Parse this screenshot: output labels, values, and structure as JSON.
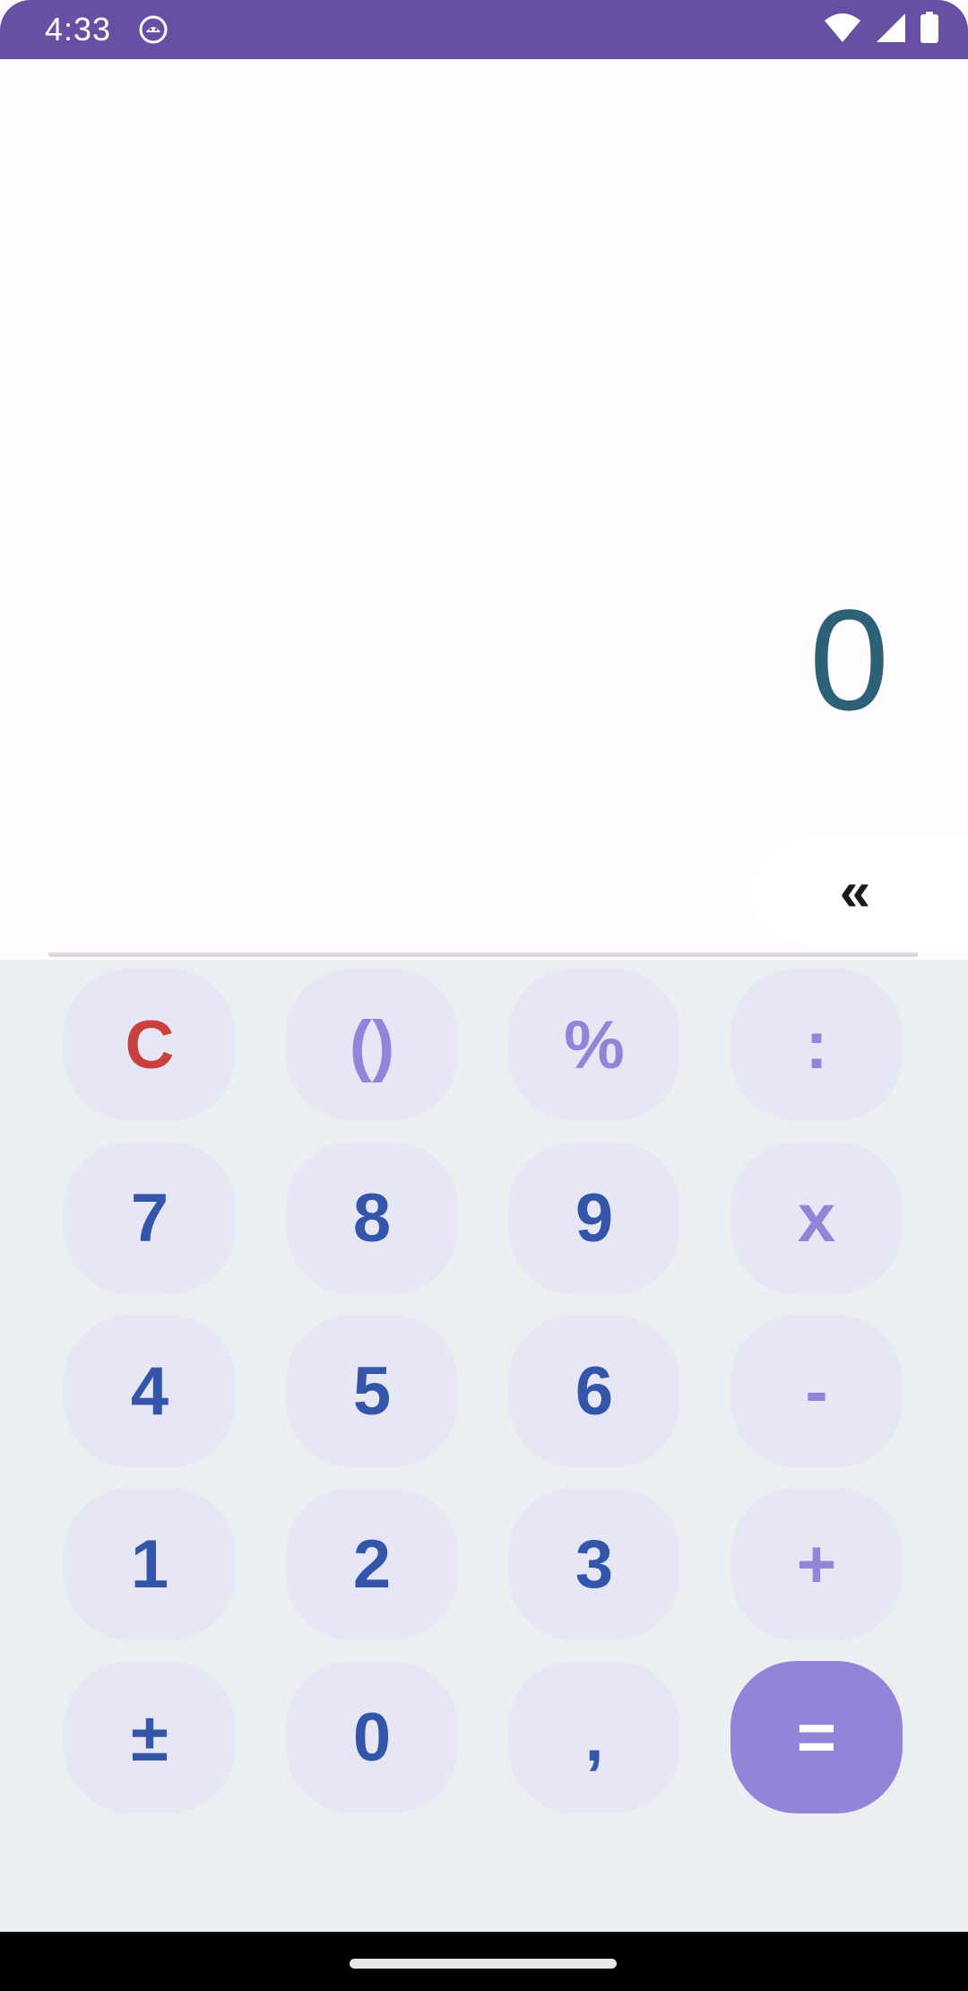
{
  "status_bar": {
    "time": "4:33",
    "app_icon": "android-face-icon",
    "wifi_icon": "wifi-icon",
    "signal_icon": "cell-signal-icon",
    "battery_icon": "battery-icon"
  },
  "display": {
    "result": "0",
    "result_color": "#2c6178",
    "backspace_label": "«"
  },
  "keypad": {
    "row1": [
      "C",
      "()",
      "%",
      ":"
    ],
    "row2": [
      "7",
      "8",
      "9",
      "x"
    ],
    "row3": [
      "4",
      "5",
      "6",
      "-"
    ],
    "row4": [
      "1",
      "2",
      "3",
      "+"
    ],
    "row5": [
      "±",
      "0",
      ",",
      "="
    ]
  },
  "colors": {
    "accent": "#6750a4",
    "digit": "#3355aa",
    "operator": "#9384d9",
    "clear": "#c8413e",
    "key_background": "#e7e6f5",
    "equals_background": "#9484d9"
  }
}
